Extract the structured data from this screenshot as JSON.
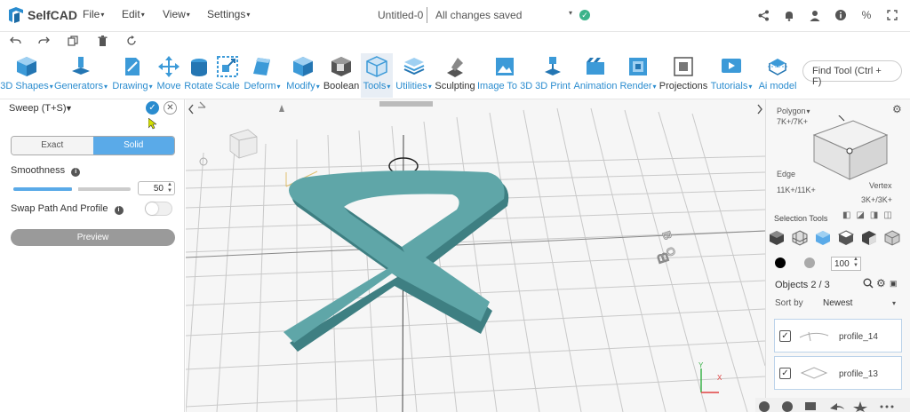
{
  "app": {
    "name": "SelfCAD"
  },
  "menu": {
    "file": "File",
    "edit": "Edit",
    "view": "View",
    "settings": "Settings"
  },
  "document": {
    "title": "Untitled-0",
    "status": "All changes saved"
  },
  "topright_icons": [
    "share-icon",
    "bell-icon",
    "user-icon",
    "info-icon",
    "percent-icon",
    "expand-icon"
  ],
  "quick_icons": [
    "undo-icon",
    "redo-icon",
    "copy-icon",
    "trash-icon",
    "refresh-icon"
  ],
  "toolbar": {
    "shapes": "3D Shapes",
    "generators": "Generators",
    "drawing": "Drawing",
    "move": "Move",
    "rotate": "Rotate",
    "scale": "Scale",
    "deform": "Deform",
    "modify": "Modify",
    "boolean": "Boolean",
    "tools": "Tools",
    "utilities": "Utilities",
    "sculpting": "Sculpting",
    "image3d": "Image To 3D",
    "print3d": "3D Print",
    "animation": "Animation",
    "render": "Render",
    "projections": "Projections",
    "tutorials": "Tutorials",
    "aimodel": "Ai model",
    "find_placeholder": "Find Tool (Ctrl + F)"
  },
  "sweep_panel": {
    "title": "Sweep (T+S)",
    "mode_exact": "Exact",
    "mode_solid": "Solid",
    "smoothness_label": "Smoothness",
    "smoothness_value": "50",
    "smoothness_level": 0.5,
    "swap_label": "Swap Path And Profile",
    "swap_on": false,
    "preview_label": "Preview"
  },
  "viewport": {
    "axis_y": "Y",
    "axis_x": "X"
  },
  "right_panel": {
    "polygon_label": "Polygon",
    "polygon_count": "7K+/7K+",
    "edge_label": "Edge",
    "edge_count": "11K+/11K+",
    "vertex_label": "Vertex",
    "vertex_count": "3K+/3K+",
    "selection_tools": "Selection Tools",
    "opacity": "100",
    "objects_label": "Objects 2 / 3",
    "sort_label": "Sort by",
    "sort_value": "Newest",
    "objects": [
      {
        "name": "profile_14",
        "checked": true
      },
      {
        "name": "profile_13",
        "checked": true
      }
    ]
  },
  "colors": {
    "accent": "#2a8ccf",
    "solid_active": "#5aaae8",
    "model": "#5fa6a8",
    "saved": "#3cb38a"
  }
}
